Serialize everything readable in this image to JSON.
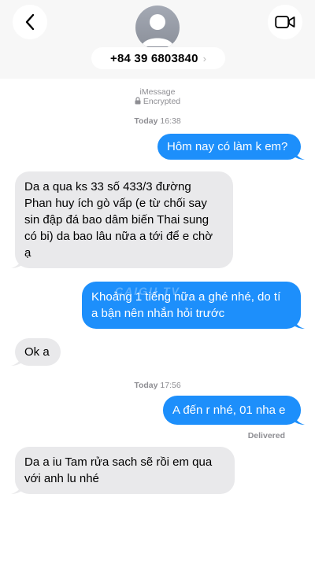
{
  "header": {
    "contact": "+84 39 6803840",
    "chevron": "›",
    "back_icon": "chevron-left-icon",
    "video_icon": "video-camera-icon"
  },
  "thread_info": {
    "service": "iMessage",
    "encryption": "Encrypted"
  },
  "timestamps": [
    {
      "day": "Today",
      "time": "16:38"
    },
    {
      "day": "Today",
      "time": "17:56"
    }
  ],
  "messages": [
    {
      "direction": "sent",
      "text": "Hôm nay có làm k em?"
    },
    {
      "direction": "received",
      "lines": [
        "Da a qua ks 33 số 433/3 đường",
        "Phan huy ích gò vấp (e từ chối say",
        "sin đập đá bao dâm biến Thai sung",
        "có bi) da bao lâu nữa a tới để e chờ",
        "ạ"
      ]
    },
    {
      "direction": "sent",
      "lines": [
        "Khoảng 1 tiếng nữa a ghé nhé, do tí",
        "a bận nên nhắn hỏi trước"
      ]
    },
    {
      "direction": "received",
      "text": "Ok a"
    },
    {
      "direction": "sent",
      "text": "A đến r nhé, 01 nha e"
    },
    {
      "direction": "received",
      "lines": [
        "Da  a iu Tam rửa sach sẽ rồi em qua",
        "với anh lu nhé"
      ]
    }
  ],
  "status": {
    "delivered": "Delivered"
  },
  "watermark": "CAIGU.TV",
  "colors": {
    "sent_bubble": "#1d8ffb",
    "received_bubble": "#e9e9eb",
    "meta_text": "#8e8e93",
    "header_bg": "#f7f7f7"
  }
}
